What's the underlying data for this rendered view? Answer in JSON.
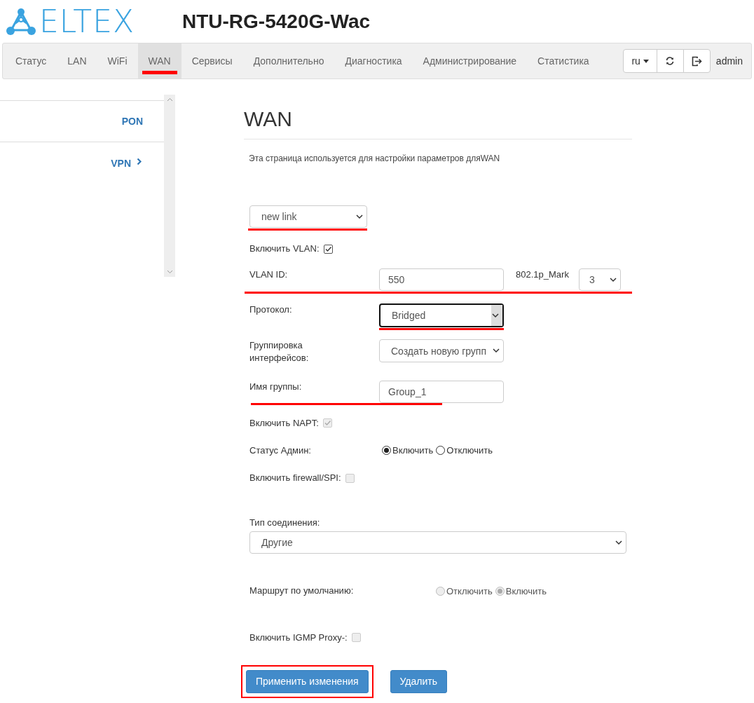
{
  "header": {
    "logo_text": "ELTEX",
    "device_title": "NTU-RG-5420G-Wac"
  },
  "nav": {
    "items": [
      {
        "label": "Статус",
        "selected": false,
        "underlined": false
      },
      {
        "label": "LAN",
        "selected": false,
        "underlined": false
      },
      {
        "label": "WiFi",
        "selected": false,
        "underlined": false
      },
      {
        "label": "WAN",
        "selected": true,
        "underlined": true
      },
      {
        "label": "Сервисы",
        "selected": false,
        "underlined": false
      },
      {
        "label": "Дополнительно",
        "selected": false,
        "underlined": false
      },
      {
        "label": "Диагностика",
        "selected": false,
        "underlined": false
      },
      {
        "label": "Администрирование",
        "selected": false,
        "underlined": false
      },
      {
        "label": "Статистика",
        "selected": false,
        "underlined": false
      }
    ],
    "language": "ru",
    "user": "admin"
  },
  "sidebar": {
    "items": [
      {
        "label": "PON",
        "has_arrow": false
      },
      {
        "label": "VPN",
        "has_arrow": true
      }
    ]
  },
  "main": {
    "title": "WAN",
    "description": "Эта страница используется для настройки параметров дляWAN",
    "rows": [
      {
        "kind": "select",
        "value": "new link",
        "underlined": true
      },
      {
        "kind": "checkbox",
        "label": "Включить VLAN:",
        "checked": true,
        "disabled": false
      },
      {
        "kind": "vlan",
        "label": "VLAN ID:",
        "value": "550",
        "mark_label": "802.1p_Mark",
        "mark_value": "3",
        "underlined": true
      },
      {
        "kind": "labeled-select",
        "label": "Протокол:",
        "value": "Bridged",
        "focused": true,
        "underlined": true
      },
      {
        "kind": "labeled-select",
        "label": "Группировка интерфейсов:",
        "value": "Создать новую групп",
        "focused": false
      },
      {
        "kind": "labeled-input",
        "label": "Имя группы:",
        "value": "Group_1",
        "underlined": true
      },
      {
        "kind": "checkbox",
        "label": "Включить NAPT:",
        "checked": true,
        "disabled": true
      },
      {
        "kind": "radio",
        "label": "Статус Админ:",
        "disabled": false,
        "options": [
          {
            "label": "Включить",
            "selected": true
          },
          {
            "label": "Отключить",
            "selected": false
          }
        ]
      },
      {
        "kind": "checkbox",
        "label": "Включить firewall/SPI:",
        "checked": false,
        "disabled": true
      },
      {
        "kind": "block-select",
        "label": "Тип соединения:",
        "value": "Другие"
      },
      {
        "kind": "radio",
        "label": "Маршрут по умолчанию:",
        "disabled": true,
        "options": [
          {
            "label": "Отключить",
            "selected": false
          },
          {
            "label": "Включить",
            "selected": true
          }
        ]
      },
      {
        "kind": "checkbox",
        "label": "Включить IGMP Proxy-:",
        "checked": false,
        "disabled": true
      }
    ],
    "buttons": [
      {
        "label": "Применить изменения",
        "framed": true
      },
      {
        "label": "Удалить",
        "framed": false
      }
    ]
  }
}
